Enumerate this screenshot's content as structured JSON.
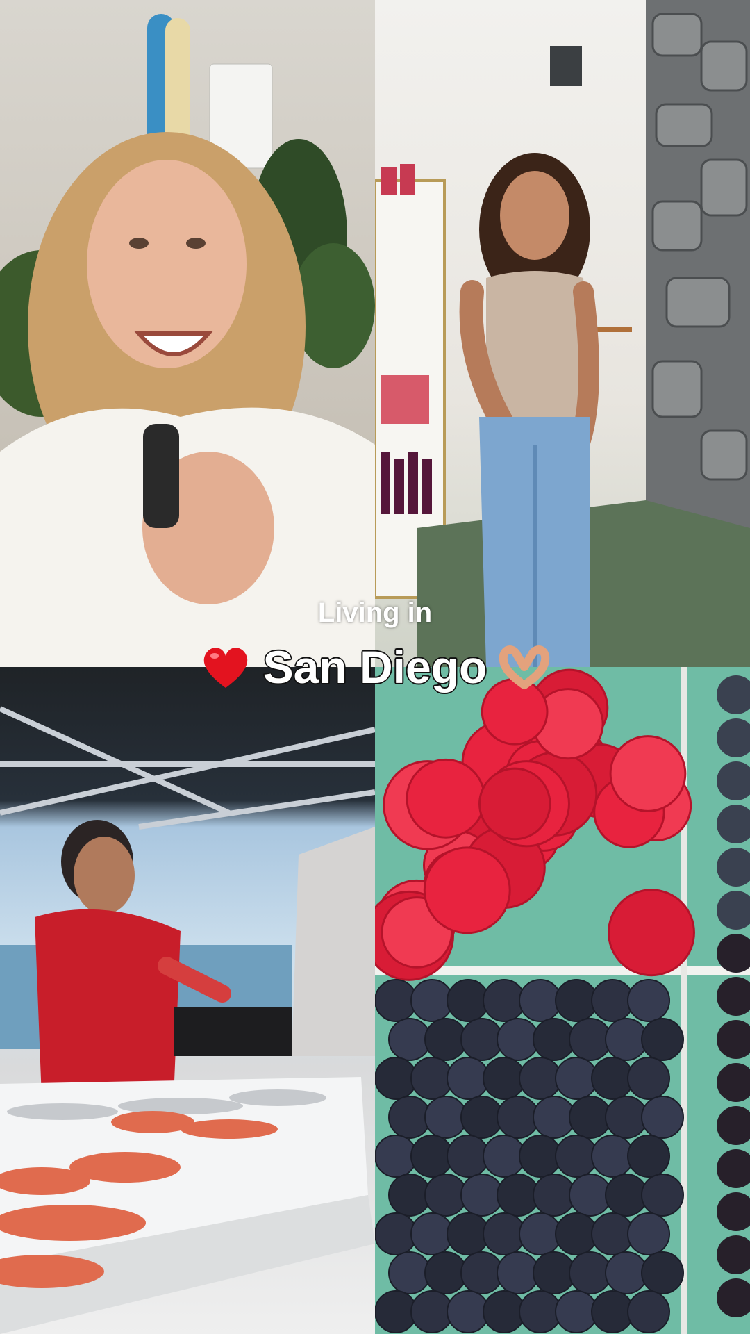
{
  "caption": {
    "line1": "Living in",
    "line2": "San Diego",
    "emoji_left": "heart-icon",
    "emoji_right": "heart-hands-icon",
    "heart_color": "#e3131f"
  },
  "tiles": [
    {
      "name": "woman-talking-with-mic"
    },
    {
      "name": "woman-in-salon"
    },
    {
      "name": "fish-market-vendor"
    },
    {
      "name": "berries-baskets"
    }
  ]
}
